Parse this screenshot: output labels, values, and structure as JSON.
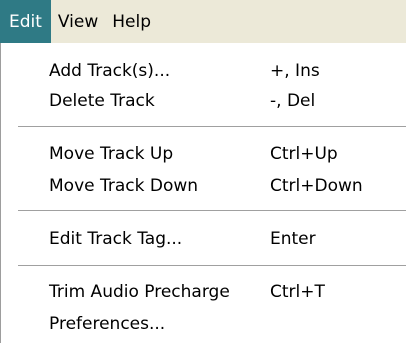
{
  "menubar": {
    "items": [
      {
        "label": "Edit"
      },
      {
        "label": "View"
      },
      {
        "label": "Help"
      }
    ]
  },
  "edit_menu": {
    "items": [
      {
        "label": "Add Track(s)...",
        "shortcut": "+, Ins"
      },
      {
        "label": "Delete Track",
        "shortcut": "-, Del"
      },
      {
        "label": "Move Track Up",
        "shortcut": "Ctrl+Up"
      },
      {
        "label": "Move Track Down",
        "shortcut": "Ctrl+Down"
      },
      {
        "label": "Edit Track Tag...",
        "shortcut": "Enter"
      },
      {
        "label": "Trim Audio Precharge",
        "shortcut": "Ctrl+T"
      },
      {
        "label": "Preferences...",
        "shortcut": ""
      }
    ]
  },
  "colors": {
    "active_menu_bg": "#2f7a85",
    "menubar_bg": "#ece9d8",
    "dropdown_bg": "#ffffff"
  }
}
